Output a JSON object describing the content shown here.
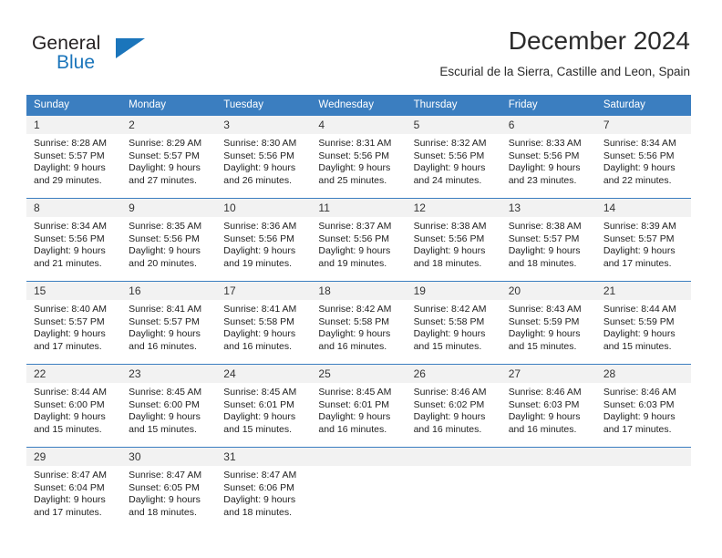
{
  "logo": {
    "primary_text": "General",
    "secondary_text": "Blue",
    "triangle_icon": "triangle-icon",
    "primary_color": "#231f20",
    "accent_color": "#1b75bb"
  },
  "header": {
    "title": "December 2024",
    "subtitle": "Escurial de la Sierra, Castille and Leon, Spain"
  },
  "calendar": {
    "header_bg_color": "#3b7ec0",
    "daynum_bg_color": "#f2f2f2",
    "weekday_headers": [
      "Sunday",
      "Monday",
      "Tuesday",
      "Wednesday",
      "Thursday",
      "Friday",
      "Saturday"
    ],
    "weeks": [
      [
        {
          "day": "1",
          "sunrise": "Sunrise: 8:28 AM",
          "sunset": "Sunset: 5:57 PM",
          "daylight_line1": "Daylight: 9 hours",
          "daylight_line2": "and 29 minutes."
        },
        {
          "day": "2",
          "sunrise": "Sunrise: 8:29 AM",
          "sunset": "Sunset: 5:57 PM",
          "daylight_line1": "Daylight: 9 hours",
          "daylight_line2": "and 27 minutes."
        },
        {
          "day": "3",
          "sunrise": "Sunrise: 8:30 AM",
          "sunset": "Sunset: 5:56 PM",
          "daylight_line1": "Daylight: 9 hours",
          "daylight_line2": "and 26 minutes."
        },
        {
          "day": "4",
          "sunrise": "Sunrise: 8:31 AM",
          "sunset": "Sunset: 5:56 PM",
          "daylight_line1": "Daylight: 9 hours",
          "daylight_line2": "and 25 minutes."
        },
        {
          "day": "5",
          "sunrise": "Sunrise: 8:32 AM",
          "sunset": "Sunset: 5:56 PM",
          "daylight_line1": "Daylight: 9 hours",
          "daylight_line2": "and 24 minutes."
        },
        {
          "day": "6",
          "sunrise": "Sunrise: 8:33 AM",
          "sunset": "Sunset: 5:56 PM",
          "daylight_line1": "Daylight: 9 hours",
          "daylight_line2": "and 23 minutes."
        },
        {
          "day": "7",
          "sunrise": "Sunrise: 8:34 AM",
          "sunset": "Sunset: 5:56 PM",
          "daylight_line1": "Daylight: 9 hours",
          "daylight_line2": "and 22 minutes."
        }
      ],
      [
        {
          "day": "8",
          "sunrise": "Sunrise: 8:34 AM",
          "sunset": "Sunset: 5:56 PM",
          "daylight_line1": "Daylight: 9 hours",
          "daylight_line2": "and 21 minutes."
        },
        {
          "day": "9",
          "sunrise": "Sunrise: 8:35 AM",
          "sunset": "Sunset: 5:56 PM",
          "daylight_line1": "Daylight: 9 hours",
          "daylight_line2": "and 20 minutes."
        },
        {
          "day": "10",
          "sunrise": "Sunrise: 8:36 AM",
          "sunset": "Sunset: 5:56 PM",
          "daylight_line1": "Daylight: 9 hours",
          "daylight_line2": "and 19 minutes."
        },
        {
          "day": "11",
          "sunrise": "Sunrise: 8:37 AM",
          "sunset": "Sunset: 5:56 PM",
          "daylight_line1": "Daylight: 9 hours",
          "daylight_line2": "and 19 minutes."
        },
        {
          "day": "12",
          "sunrise": "Sunrise: 8:38 AM",
          "sunset": "Sunset: 5:56 PM",
          "daylight_line1": "Daylight: 9 hours",
          "daylight_line2": "and 18 minutes."
        },
        {
          "day": "13",
          "sunrise": "Sunrise: 8:38 AM",
          "sunset": "Sunset: 5:57 PM",
          "daylight_line1": "Daylight: 9 hours",
          "daylight_line2": "and 18 minutes."
        },
        {
          "day": "14",
          "sunrise": "Sunrise: 8:39 AM",
          "sunset": "Sunset: 5:57 PM",
          "daylight_line1": "Daylight: 9 hours",
          "daylight_line2": "and 17 minutes."
        }
      ],
      [
        {
          "day": "15",
          "sunrise": "Sunrise: 8:40 AM",
          "sunset": "Sunset: 5:57 PM",
          "daylight_line1": "Daylight: 9 hours",
          "daylight_line2": "and 17 minutes."
        },
        {
          "day": "16",
          "sunrise": "Sunrise: 8:41 AM",
          "sunset": "Sunset: 5:57 PM",
          "daylight_line1": "Daylight: 9 hours",
          "daylight_line2": "and 16 minutes."
        },
        {
          "day": "17",
          "sunrise": "Sunrise: 8:41 AM",
          "sunset": "Sunset: 5:58 PM",
          "daylight_line1": "Daylight: 9 hours",
          "daylight_line2": "and 16 minutes."
        },
        {
          "day": "18",
          "sunrise": "Sunrise: 8:42 AM",
          "sunset": "Sunset: 5:58 PM",
          "daylight_line1": "Daylight: 9 hours",
          "daylight_line2": "and 16 minutes."
        },
        {
          "day": "19",
          "sunrise": "Sunrise: 8:42 AM",
          "sunset": "Sunset: 5:58 PM",
          "daylight_line1": "Daylight: 9 hours",
          "daylight_line2": "and 15 minutes."
        },
        {
          "day": "20",
          "sunrise": "Sunrise: 8:43 AM",
          "sunset": "Sunset: 5:59 PM",
          "daylight_line1": "Daylight: 9 hours",
          "daylight_line2": "and 15 minutes."
        },
        {
          "day": "21",
          "sunrise": "Sunrise: 8:44 AM",
          "sunset": "Sunset: 5:59 PM",
          "daylight_line1": "Daylight: 9 hours",
          "daylight_line2": "and 15 minutes."
        }
      ],
      [
        {
          "day": "22",
          "sunrise": "Sunrise: 8:44 AM",
          "sunset": "Sunset: 6:00 PM",
          "daylight_line1": "Daylight: 9 hours",
          "daylight_line2": "and 15 minutes."
        },
        {
          "day": "23",
          "sunrise": "Sunrise: 8:45 AM",
          "sunset": "Sunset: 6:00 PM",
          "daylight_line1": "Daylight: 9 hours",
          "daylight_line2": "and 15 minutes."
        },
        {
          "day": "24",
          "sunrise": "Sunrise: 8:45 AM",
          "sunset": "Sunset: 6:01 PM",
          "daylight_line1": "Daylight: 9 hours",
          "daylight_line2": "and 15 minutes."
        },
        {
          "day": "25",
          "sunrise": "Sunrise: 8:45 AM",
          "sunset": "Sunset: 6:01 PM",
          "daylight_line1": "Daylight: 9 hours",
          "daylight_line2": "and 16 minutes."
        },
        {
          "day": "26",
          "sunrise": "Sunrise: 8:46 AM",
          "sunset": "Sunset: 6:02 PM",
          "daylight_line1": "Daylight: 9 hours",
          "daylight_line2": "and 16 minutes."
        },
        {
          "day": "27",
          "sunrise": "Sunrise: 8:46 AM",
          "sunset": "Sunset: 6:03 PM",
          "daylight_line1": "Daylight: 9 hours",
          "daylight_line2": "and 16 minutes."
        },
        {
          "day": "28",
          "sunrise": "Sunrise: 8:46 AM",
          "sunset": "Sunset: 6:03 PM",
          "daylight_line1": "Daylight: 9 hours",
          "daylight_line2": "and 17 minutes."
        }
      ],
      [
        {
          "day": "29",
          "sunrise": "Sunrise: 8:47 AM",
          "sunset": "Sunset: 6:04 PM",
          "daylight_line1": "Daylight: 9 hours",
          "daylight_line2": "and 17 minutes."
        },
        {
          "day": "30",
          "sunrise": "Sunrise: 8:47 AM",
          "sunset": "Sunset: 6:05 PM",
          "daylight_line1": "Daylight: 9 hours",
          "daylight_line2": "and 18 minutes."
        },
        {
          "day": "31",
          "sunrise": "Sunrise: 8:47 AM",
          "sunset": "Sunset: 6:06 PM",
          "daylight_line1": "Daylight: 9 hours",
          "daylight_line2": "and 18 minutes."
        },
        {
          "day": "",
          "sunrise": "",
          "sunset": "",
          "daylight_line1": "",
          "daylight_line2": ""
        },
        {
          "day": "",
          "sunrise": "",
          "sunset": "",
          "daylight_line1": "",
          "daylight_line2": ""
        },
        {
          "day": "",
          "sunrise": "",
          "sunset": "",
          "daylight_line1": "",
          "daylight_line2": ""
        },
        {
          "day": "",
          "sunrise": "",
          "sunset": "",
          "daylight_line1": "",
          "daylight_line2": ""
        }
      ]
    ]
  }
}
